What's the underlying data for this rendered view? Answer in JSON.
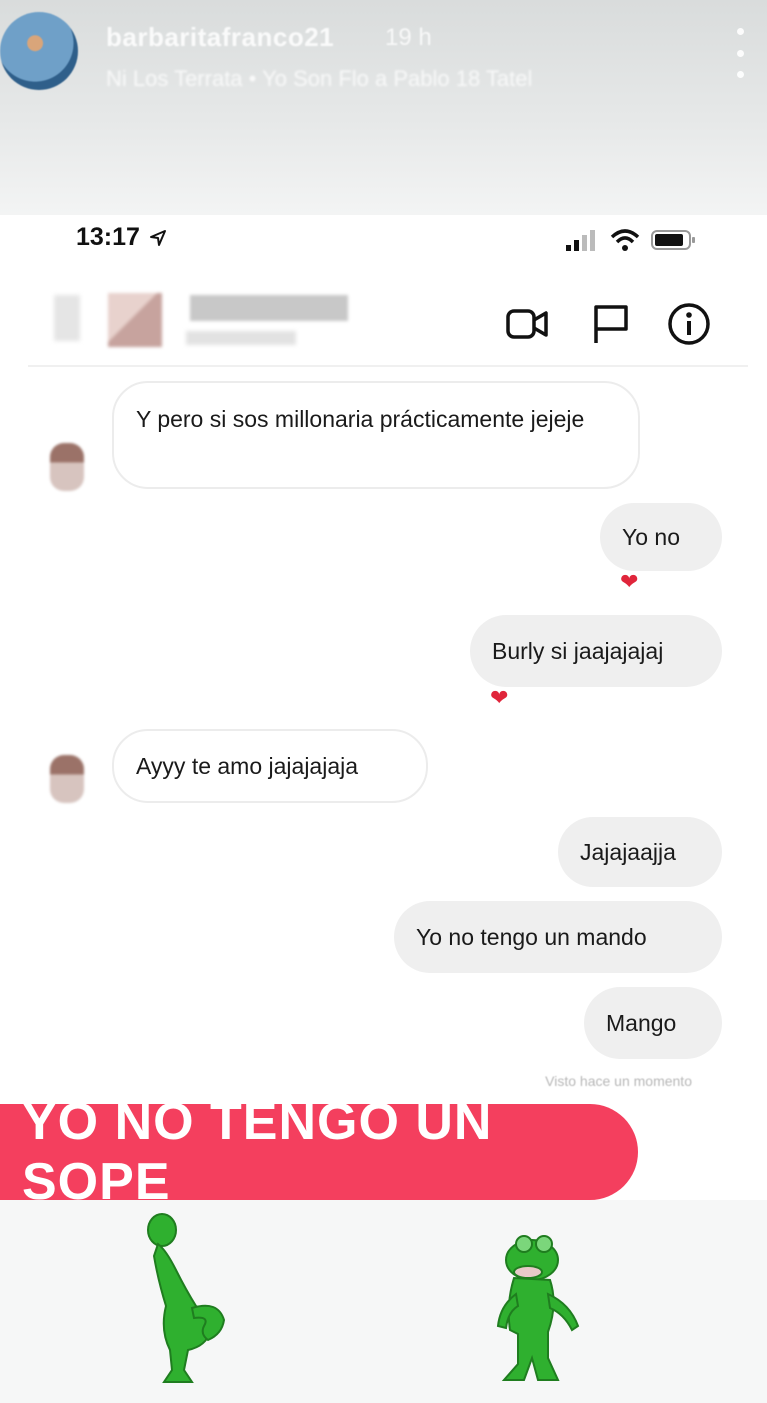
{
  "story": {
    "username": "barbaritafranco21",
    "time": "19 h",
    "subtitle": "Ni Los Terrata • Yo Son Flo a Pablo 18 Tatel",
    "sticker_text": "YO NO TENGO UN SOPE",
    "sticker_color": "#f43f5e"
  },
  "status_bar": {
    "time": "13:17"
  },
  "dm_header": {
    "username": "",
    "subtitle": ""
  },
  "messages": [
    {
      "side": "in",
      "text": "Y pero si sos millonaria prácticamente jejeje",
      "reaction": ""
    },
    {
      "side": "out",
      "text": "Yo no",
      "reaction": "❤"
    },
    {
      "side": "out",
      "text": "Burly si jaajajajaj",
      "reaction": "❤"
    },
    {
      "side": "in",
      "text": "Ayyy te amo jajajajaja",
      "reaction": ""
    },
    {
      "side": "out",
      "text": "Jajajaajja",
      "reaction": ""
    },
    {
      "side": "out",
      "text": "Yo no tengo un mando",
      "reaction": ""
    },
    {
      "side": "out",
      "text": "Mango",
      "reaction": ""
    }
  ],
  "seen_text": "Visto hace un momento",
  "icons": [
    "video-call-icon",
    "flag-icon",
    "info-icon",
    "location-arrow-icon",
    "signal-icon",
    "wifi-icon",
    "battery-icon",
    "more-options-icon"
  ],
  "colors": {
    "heart": "#e0253b",
    "frog_green": "#2fb02f"
  }
}
